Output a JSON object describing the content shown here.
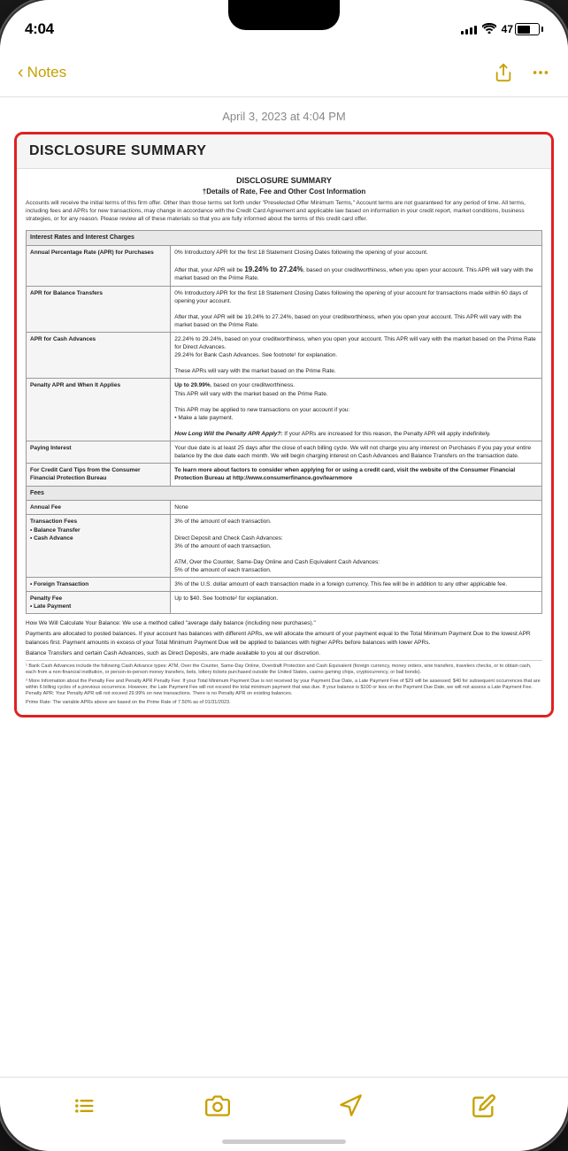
{
  "statusBar": {
    "time": "4:04",
    "battery": "47"
  },
  "navBar": {
    "backLabel": "Notes",
    "shareLabel": "share",
    "moreLabel": "more"
  },
  "dateHeading": "April 3, 2023 at 4:04 PM",
  "document": {
    "title": "DISCLOSURE SUMMARY",
    "mainTitle": "DISCLOSURE SUMMARY",
    "subtitle": "†Details of Rate, Fee and Other Cost Information",
    "intro": "Accounts will receive the initial terms of this firm offer. Other than those terms set forth under \"Preselected Offer Minimum Terms,\" Account terms are not guaranteed for any period of time. All terms, including fees and APRs for new transactions, may change in accordance with the Credit Card Agreement and applicable law based on information in your credit report, market conditions, business strategies, or for any reason. Please review all of these materials so that you are fully informed about the terms of this credit card offer.",
    "table": {
      "section1Header": "Interest Rates and Interest Charges",
      "rows": [
        {
          "label": "Annual Percentage Rate (APR) for Purchases",
          "value": "0% Introductory APR for the first 18 Statement Closing Dates following the opening of your account.\n\nAfter that, your APR will be 19.24% to 27.24%, based on your creditworthiness, when you open your account. This APR will vary with the market based on the Prime Rate."
        },
        {
          "label": "APR for Balance Transfers",
          "value": "0% Introductory APR for the first 18 Statement Closing Dates following the opening of your account for transactions made within 60 days of opening your account.\n\nAfter that, your APR will be 19.24% to 27.24%, based on your creditworthiness, when you open your account. This APR will vary with the market based on the Prime Rate."
        },
        {
          "label": "APR for Cash Advances",
          "value": "22.24% to 29.24%, based on your creditworthiness, when you open your account. This APR will vary with the market based on the Prime Rate for Direct Advances.\n29.24% for Bank Cash Advances. See footnote¹ for explanation.\n\nThese APRs will vary with the market based on the Prime Rate."
        },
        {
          "label": "Penalty APR and When It Applies",
          "value": "Up to 29.99%, based on your creditworthiness.\nThis APR will vary with the market based on the Prime Rate.\n\nThis APR may be applied to new transactions on your account if you:\n• Make a late payment.\n\nHow Long Will the Penalty APR Apply?: If your APRs are increased for this reason, the Penalty APR will apply indefinitely."
        },
        {
          "label": "Paying Interest",
          "value": "Your due date is at least 25 days after the close of each billing cycle. We will not charge you any interest on Purchases if you pay your entire balance by the due date each month. We will begin charging interest on Cash Advances and Balance Transfers on the transaction date."
        },
        {
          "label": "For Credit Card Tips from the Consumer Financial Protection Bureau",
          "value": "To learn more about factors to consider when applying for or using a credit card, visit the website of the Consumer Financial Protection Bureau at http://www.consumerfinance.gov/learnmore"
        }
      ],
      "section2Header": "Fees",
      "feeRows": [
        {
          "label": "Annual Fee",
          "value": "None"
        },
        {
          "label": "Transaction Fees\n• Balance Transfer\n• Cash Advance",
          "value": "3% of the amount of each transaction.\n\nDirect Deposit and Check Cash Advances:\n3% of the amount of each transaction.\n\nATM, Over the Counter, Same-Day Online and Cash Equivalent Cash Advances:\n5% of the amount of each transaction."
        },
        {
          "label": "• Foreign Transaction",
          "value": "3% of the U.S. dollar amount of each transaction made in a foreign currency. This fee will be in addition to any other applicable fee."
        },
        {
          "label": "Penalty Fee\n• Late Payment",
          "value": "Up to $40. See footnote² for explanation."
        }
      ]
    },
    "balanceCalcText": "How We Will Calculate Your Balance: We use a method called \"average daily balance (including new purchases).\"",
    "allocationText": "Payments are allocated to posted balances. If your account has balances with different APRs, we will allocate the amount of your payment equal to the Total Minimum Payment Due to the lowest APR balances first. Payment amounts in excess of your Total Minimum Payment Due will be applied to balances with higher APRs before balances with lower APRs.",
    "balanceTransferText": "Balance Transfers and certain Cash Advances, such as Direct Deposits, are made available to you at our discretion.",
    "cashAdvanceText": "¹ Bank Cash Advances include the following Cash Advance types: ATM, Over the Counter, Same-Day Online, Overdraft Protection and Cash Equivalent (foreign currency, money orders, wire transfers, travelers checks, or to obtain cash, each from a non-financial institution, or person-to-person money transfers, bets, lottery tickets purchased outside the United States, casino gaming chips, cryptocurrency, or bail bonds).",
    "penaltyFeeText": "² More Information about the Penalty Fee and Penalty APR\nPenalty Fee: If your Total Minimum Payment Due is not received by your Payment Due Date, a Late Payment Fee of $29 will be assessed; $40 for subsequent occurrences that are within 6 billing cycles of a previous occurrence. However, the Late Payment Fee will not exceed the total minimum payment that was due. If your balance is $100 or less on the Payment Due Date, we will not assess a Late Payment Fee.\nPenalty APR: Your Penalty APR will not exceed 29.99% on new transactions. There is no Penalty APR on existing balances.",
    "primeRateText": "Prime Rate: The variable APRs above are based on the Prime Rate of 7.50% as of 01/31/2023."
  },
  "toolbar": {
    "listIcon": "list-bullet-icon",
    "cameraIcon": "camera-icon",
    "locationIcon": "location-icon",
    "editIcon": "edit-icon"
  }
}
